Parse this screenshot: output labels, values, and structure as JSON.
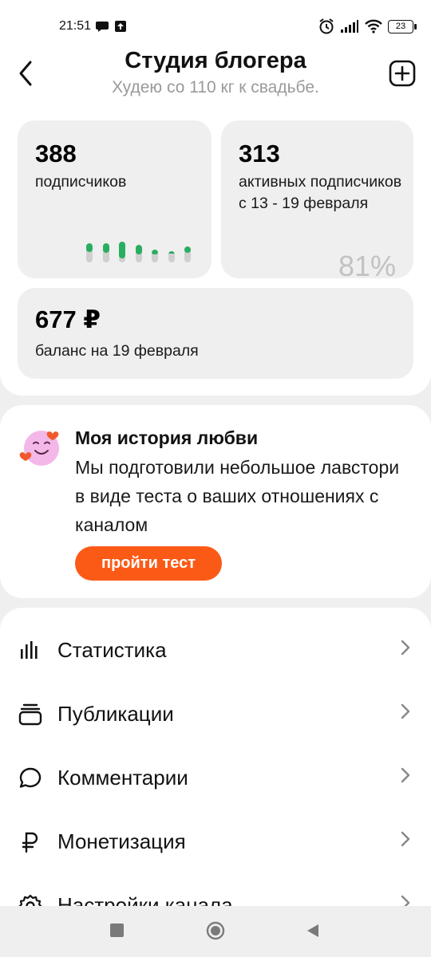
{
  "status_bar": {
    "time": "21:51",
    "battery": "23",
    "icons": [
      "chat-bubble-icon",
      "upload-icon",
      "alarm-icon",
      "signal-icon",
      "wifi-icon",
      "battery-icon"
    ]
  },
  "header": {
    "title": "Студия блогера",
    "subtitle": "Худею со 110 кг к свадьбе.",
    "back_icon": "chevron-left-icon",
    "add_icon": "plus-square-icon"
  },
  "stats": {
    "subscribers": {
      "number": "388",
      "label": "подписчиков",
      "bars": [
        0.45,
        0.5,
        0.8,
        0.55,
        0.35,
        0.2,
        0.4
      ]
    },
    "active": {
      "number": "313",
      "label": "активных подписчиков с 13 - 19 февраля",
      "percent": "81%"
    },
    "balance": {
      "amount": "677 ₽",
      "label": "баланс на 19 февраля"
    }
  },
  "promo": {
    "title": "Моя история любви",
    "text": "Мы подготовили небольшое лавстори в виде теста о ваших отношениях с каналом",
    "button": "пройти тест",
    "icon": "heart-face-emoji-icon"
  },
  "menu": {
    "items": [
      {
        "label": "Статистика",
        "icon": "bar-chart-icon"
      },
      {
        "label": "Публикации",
        "icon": "stack-icon"
      },
      {
        "label": "Комментарии",
        "icon": "comment-icon"
      },
      {
        "label": "Монетизация",
        "icon": "ruble-icon"
      },
      {
        "label": "Настройки канала",
        "icon": "gear-icon"
      }
    ]
  },
  "colors": {
    "accent": "#fb5a16",
    "green": "#27ae60",
    "card_bg": "#efefef",
    "muted_text": "#9a9a9a"
  }
}
